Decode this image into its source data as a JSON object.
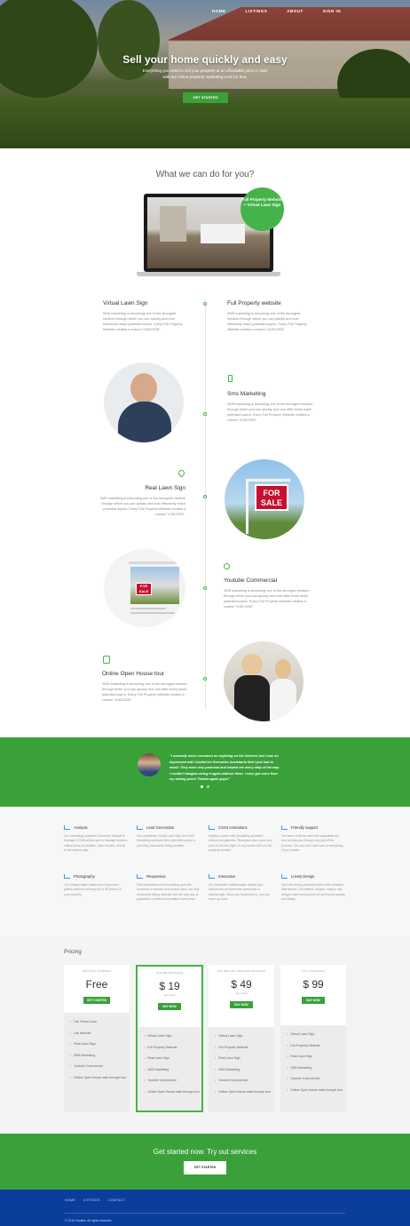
{
  "nav": {
    "items": [
      "HOME",
      "LISTINGS",
      "ABOUT",
      "SIGN IN"
    ]
  },
  "hero": {
    "title": "Sell your home quickly and easy",
    "subtitle": "Everything you need to sell your property at an affordable price or start with our online property marketing tools for free.",
    "button": "GET STARTED"
  },
  "what": {
    "title": "What we can do for you?",
    "badge": "Full Property Website + Virtual Lawn Sign"
  },
  "features": [
    {
      "title": "Virtual Lawn Sign",
      "text": "SMS marketing is becoming one of the strongest medium through which you can quickly and cost effectively reach potential buyers. Every Full Property Website creates a custom 'VLBCODE'."
    },
    {
      "title": "Full Property website",
      "text": "SMS marketing is becoming one of the strongest medium through which you can quickly and cost effectively reach potential buyers. Every Full Property Website creates a custom 'VLBCODE'."
    },
    {
      "title": "Sms Marketing",
      "text": "SMS marketing is becoming one of the strongest medium through which you can quickly and cost effec tively reach potential buyers. Every Full Property Website creates a custom 'VLBCODE'."
    },
    {
      "title": "Real Lawn Sign",
      "text": "SMS marketing is becoming one of the strongest medium through which you can quickly and cost effectively reach potential buyers. Every Full Property Website creates a custom 'VLBCODE'."
    },
    {
      "title": "Youtube Commercial",
      "text": "SMS marketing is becoming one of the strongest medium through which you can quickly and cost effec tively reach potential buyers. Every Full Property Website creates a custom 'VLBCODE'."
    },
    {
      "title": "Online Open House tour",
      "text": "SMS marketing is becoming one of the strongest medium through which you can quickly and cost effec tively reach potential buyers. Every Full Property Website creates a custom 'VLBCODE'."
    }
  ],
  "photos": {
    "sale_sign_top": "FOR",
    "sale_sign_bottom": "SALE"
  },
  "testimonial": {
    "quote": "\"I normally never comment on anything on the internet, but I was so impressed with CastleCa's Executive Assistants that I just had to email. They were very punctual and helped me every step of the way. I couldn't imagine doing it again without them. I even got more than my asking price! Thanks again guys!\""
  },
  "services": [
    {
      "title": "Analysis",
      "text": "Our immensely powerful Outcomes Manual to Manager (COM) allows you to manage mission-critical deals, schedules, open houses, and all of the related data."
    },
    {
      "title": "Lead Generation",
      "text": "Our proprietary Virtual Lawn Sign and SMS Marketing solutions drive potential buyers to your fully responsive listing website."
    },
    {
      "title": "CSS3 Animations",
      "text": "Impress buyers with beautifully animated menus and galleries. Showcase your home and put it in the best light on any device with our full property website."
    },
    {
      "title": "Friendly support",
      "text": "Our team of virtual executive assistants are here to help you through any part of the process. You can even take care of everything, if you'd prefer."
    },
    {
      "title": "Photography",
      "text": "Our Listing Pages feature two responsive gallery sections allowing up to 48 photos of your property."
    },
    {
      "title": "Responsive",
      "text": "First impressions are everything and with hundreds of devices and screen sizes, our fully responsive listing websites are the only way to guarantee a perfect presentation every time."
    },
    {
      "title": "Interactive",
      "text": "Our interactive walkthroughs delight your visitors into an interactive panorama or walkthrough. Show you experience it, you can never go back."
    },
    {
      "title": "Lovely Design",
      "text": "Don't like losing potential buyers with outdated alternatives. Our refined, elegant, easy to use designs have been proven to sell homes quickly and easily."
    }
  ],
  "pricing": {
    "title": "Pricing",
    "per": "per month",
    "plans": [
      {
        "tier": "GETTING STARTED",
        "price": "Free",
        "button": "GET STARTED",
        "features": [
          "Lite Virtual Lawn",
          "Lite Website",
          "Real Lawn Sign",
          "SMS Marketing",
          "Youtube Commercial",
          "Online Open House walk-through tour"
        ]
      },
      {
        "tier": "ONLINE PACKAGE",
        "price": "$ 19",
        "button": "BUY NOW",
        "features": [
          "Virtual Lawn Sign",
          "Full Property Website",
          "Real Lawn Sign",
          "SMS Marketing",
          "Youtube Commercial",
          "Online Open House walk-through tour"
        ]
      },
      {
        "tier": "ONLINE AND OFFLINE PACKAGE",
        "price": "$ 49",
        "button": "BUY NOW",
        "features": [
          "Virtual Lawn Sign",
          "Full Property Website",
          "Real Lawn Sign",
          "SMS Marketing",
          "Youtube Commercial",
          "Online Open House walk-through tour"
        ]
      },
      {
        "tier": "FULL PACKAGE",
        "price": "$ 99",
        "button": "BUY NOW",
        "features": [
          "Virtual Lawn Sign",
          "Full Property Website",
          "Real Lawn Sign",
          "SMS Marketing",
          "Youtube Commercial",
          "Online Open House walk-through tour"
        ]
      }
    ]
  },
  "cta": {
    "text": "Get started now. Try out services",
    "button": "GET STARTED"
  },
  "footer": {
    "nav": [
      "HOME",
      "LISTINGS",
      "CONTACT"
    ],
    "copyright": "© 2016 Castlea. All rights reserved."
  },
  "colors": {
    "green": "#3aa13a",
    "footer": "#0a3d9c"
  }
}
